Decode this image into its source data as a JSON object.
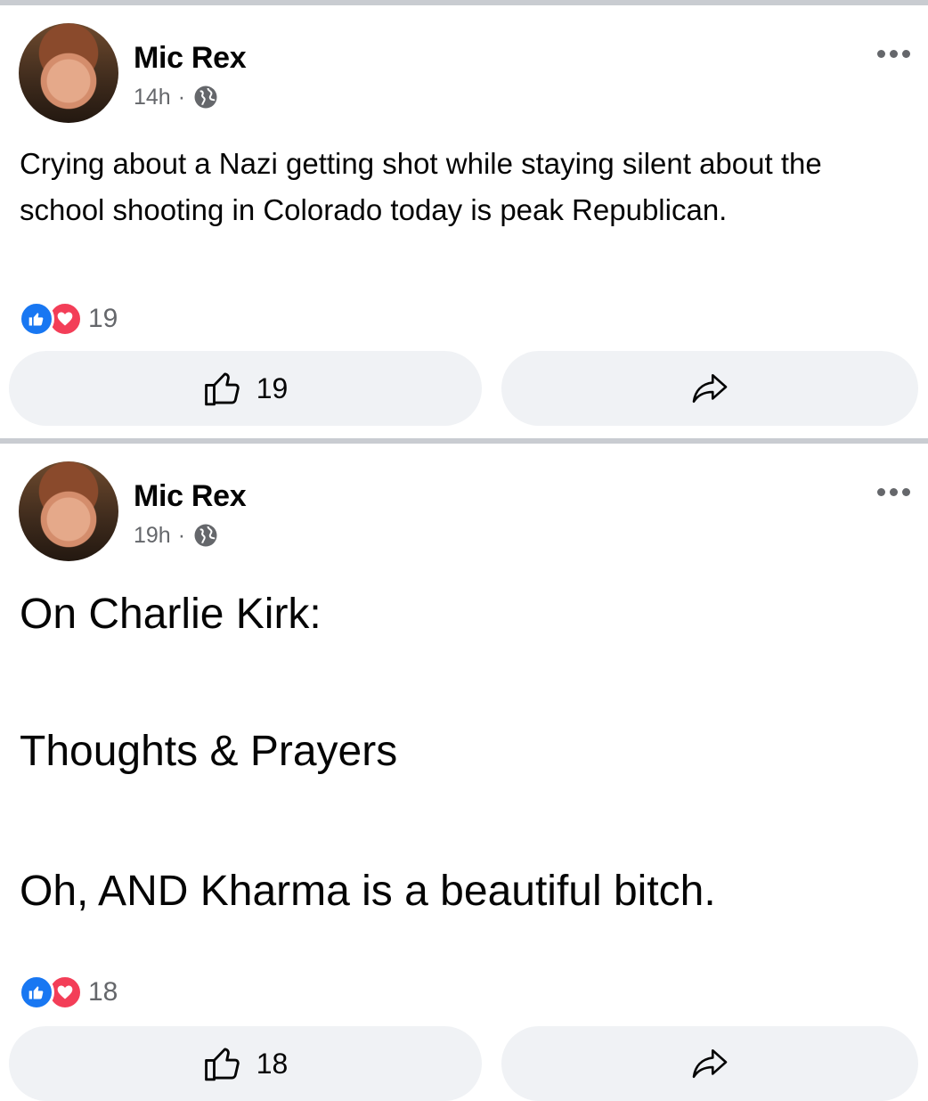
{
  "posts": [
    {
      "author": "Mic Rex",
      "time": "14h",
      "separator": "·",
      "text": "Crying about a Nazi getting shot while staying silent about the school shooting in Colorado today is peak Republican.",
      "reaction_count": "19",
      "like_count": "19"
    },
    {
      "author": "Mic Rex",
      "time": "19h",
      "separator": "·",
      "lines": [
        "On Charlie Kirk:",
        "Thoughts & Prayers",
        "Oh, AND Kharma is a beautiful bitch."
      ],
      "reaction_count": "18",
      "like_count": "18"
    }
  ],
  "icons": {
    "privacy": "globe-icon",
    "menu": "more-options-icon",
    "like": "thumbs-up-icon",
    "share": "share-arrow-icon",
    "reaction_like": "like-reaction-icon",
    "reaction_love": "love-reaction-icon"
  },
  "colors": {
    "like_blue": "#1877f2",
    "love_red": "#f33e58",
    "secondary_text": "#65676b",
    "button_bg": "#f0f2f5"
  }
}
